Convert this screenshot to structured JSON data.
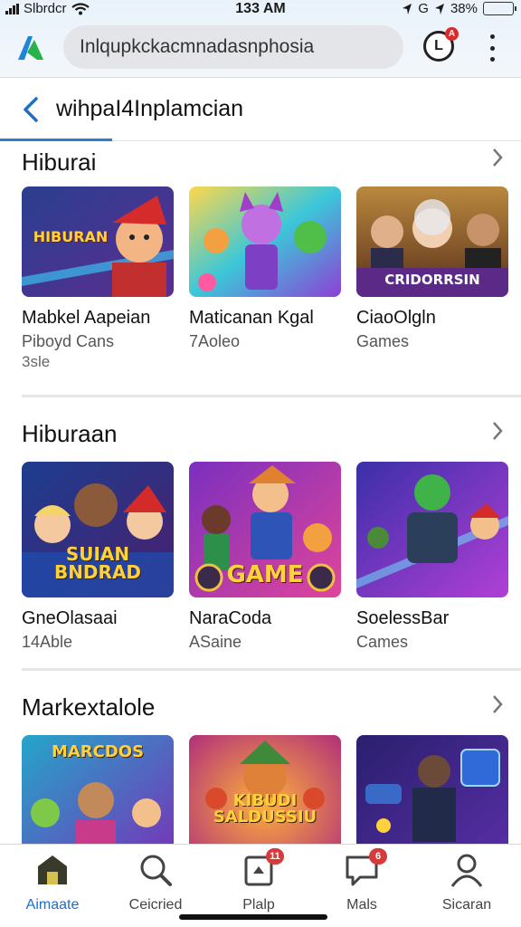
{
  "status_bar": {
    "carrier": "Slbrdcr",
    "time": "133 AM",
    "right_text": "G",
    "battery": "38%",
    "battery_level": 0.38,
    "battery_color": "#2fbf3a"
  },
  "header": {
    "search_text": "Inlqupkckacmnadasnphosia",
    "profile_letter": "L",
    "profile_badge": "A",
    "accent_color": "#2b7fd4"
  },
  "nav": {
    "title": "wihpaI4Inplamcian"
  },
  "sections": [
    {
      "title": "Hiburai",
      "cards": [
        {
          "art_text": "HIBURAN",
          "title": "Mabkel Aapeian",
          "sub": "Piboyd Cans",
          "sub2": "3sle"
        },
        {
          "art_text": "",
          "title": "Maticanan Kgal",
          "sub": "7Aoleo",
          "sub2": ""
        },
        {
          "art_text": "CRIDORRSIN",
          "title": "CiaoOlgln",
          "sub": "Games",
          "sub2": ""
        }
      ]
    },
    {
      "title": "Hiburaan",
      "cards": [
        {
          "art_text": "SUIAN BNDRAD",
          "title": "GneOlasaai",
          "sub": "14Able",
          "sub2": ""
        },
        {
          "art_text": "GAME",
          "title": "NaraCoda",
          "sub": "ASaine",
          "sub2": ""
        },
        {
          "art_text": "",
          "title": "SoelessBar",
          "sub": "Cames",
          "sub2": ""
        }
      ]
    },
    {
      "title": "Markextalole",
      "cards": [
        {
          "art_text": "MARCDOS",
          "title": "",
          "sub": "",
          "sub2": ""
        },
        {
          "art_text": "KIBUDI SALDUSSIU",
          "title": "",
          "sub": "",
          "sub2": ""
        },
        {
          "art_text": "",
          "title": "",
          "sub": "",
          "sub2": ""
        }
      ]
    }
  ],
  "bottom_nav": [
    {
      "label": "Aimaate",
      "icon": "home-icon",
      "badge": ""
    },
    {
      "label": "Ceicried",
      "icon": "search-icon",
      "badge": ""
    },
    {
      "label": "Plalp",
      "icon": "library-icon",
      "badge": "11"
    },
    {
      "label": "Mals",
      "icon": "chat-icon",
      "badge": "6"
    },
    {
      "label": "Sicaran",
      "icon": "person-icon",
      "badge": ""
    }
  ]
}
